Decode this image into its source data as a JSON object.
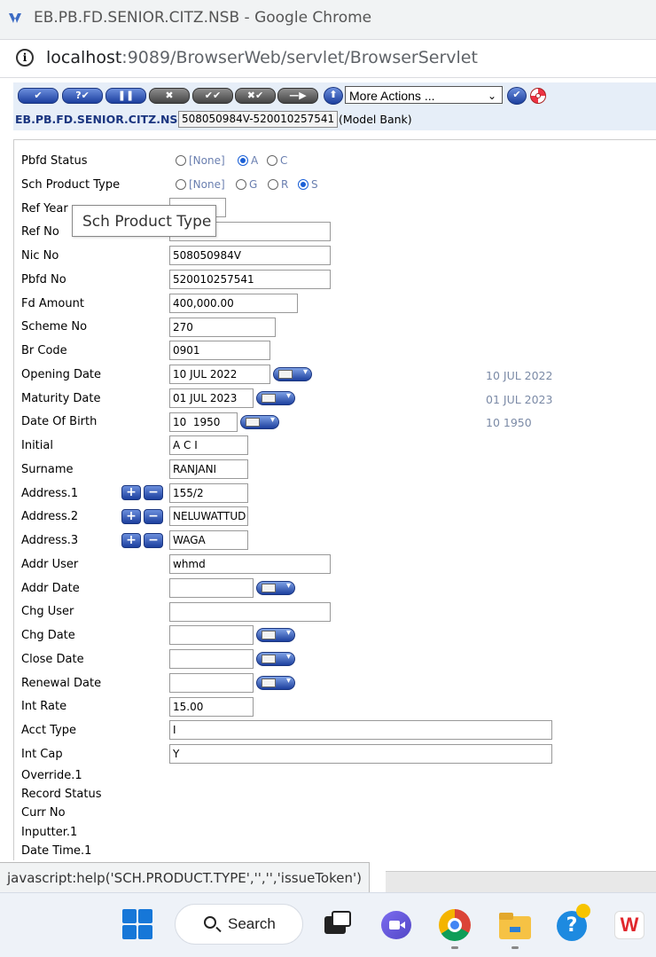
{
  "window": {
    "title": "EB.PB.FD.SENIOR.CITZ.NSB - Google Chrome"
  },
  "address_bar": {
    "host": "localhost",
    "rest": ":9089/BrowserWeb/servlet/BrowserServlet"
  },
  "toolbar": {
    "buttons": [
      "commit-icon",
      "validate-icon",
      "hold-icon",
      "delete-icon",
      "authorise-icon",
      "reverse-icon",
      "next-icon",
      "upload-icon"
    ],
    "more_actions": "More Actions ...",
    "app_name": "EB.PB.FD.SENIOR.CITZ.NSB",
    "record_id": "508050984V-520010257541",
    "company": "(Model Bank)"
  },
  "form": {
    "pbfd_status": {
      "label": "Pbfd Status",
      "options": [
        "[None]",
        "A",
        "C"
      ],
      "selected": "A"
    },
    "sch_product_type": {
      "label": "Sch Product Type",
      "options": [
        "[None]",
        "G",
        "R",
        "S"
      ],
      "selected": "S"
    },
    "tooltip": "Sch Product Type",
    "fields": {
      "ref_year": {
        "label": "Ref Year",
        "value": ""
      },
      "ref_no": {
        "label": "Ref No",
        "value": ""
      },
      "nic_no": {
        "label": "Nic No",
        "value": "508050984V"
      },
      "pbfd_no": {
        "label": "Pbfd No",
        "value": "520010257541"
      },
      "fd_amount": {
        "label": "Fd Amount",
        "value": "400,000.00"
      },
      "scheme_no": {
        "label": "Scheme No",
        "value": "270"
      },
      "br_code": {
        "label": "Br Code",
        "value": "0901"
      },
      "opening_date": {
        "label": "Opening Date",
        "value": "10 JUL 2022",
        "enrichment": "10 JUL 2022"
      },
      "maturity_date": {
        "label": "Maturity Date",
        "value": "01 JUL 2023",
        "enrichment": "01 JUL 2023"
      },
      "date_of_birth": {
        "label": "Date Of Birth",
        "value": "10  1950",
        "enrichment": "10 1950"
      },
      "initial": {
        "label": "Initial",
        "value": "A C I"
      },
      "surname": {
        "label": "Surname",
        "value": "RANJANI"
      },
      "address_1": {
        "label": "Address.1",
        "value": "155/2"
      },
      "address_2": {
        "label": "Address.2",
        "value": "NELUWATTUD"
      },
      "address_3": {
        "label": "Address.3",
        "value": "WAGA"
      },
      "addr_user": {
        "label": "Addr User",
        "value": "whmd"
      },
      "addr_date": {
        "label": "Addr Date",
        "value": ""
      },
      "chg_user": {
        "label": "Chg User",
        "value": ""
      },
      "chg_date": {
        "label": "Chg Date",
        "value": ""
      },
      "close_date": {
        "label": "Close Date",
        "value": ""
      },
      "renewal_date": {
        "label": "Renewal Date",
        "value": ""
      },
      "int_rate": {
        "label": "Int Rate",
        "value": "15.00"
      },
      "acct_type": {
        "label": "Acct Type",
        "value": "I"
      },
      "int_cap": {
        "label": "Int Cap",
        "value": "Y"
      }
    },
    "readonly_labels": {
      "override": "Override.1",
      "record_status": "Record Status",
      "curr_no": "Curr No",
      "inputter": "Inputter.1",
      "date_time": "Date Time.1"
    }
  },
  "status_bar": "javascript:help('SCH.PRODUCT.TYPE','','','issueToken')",
  "taskbar": {
    "search_label": "Search"
  }
}
